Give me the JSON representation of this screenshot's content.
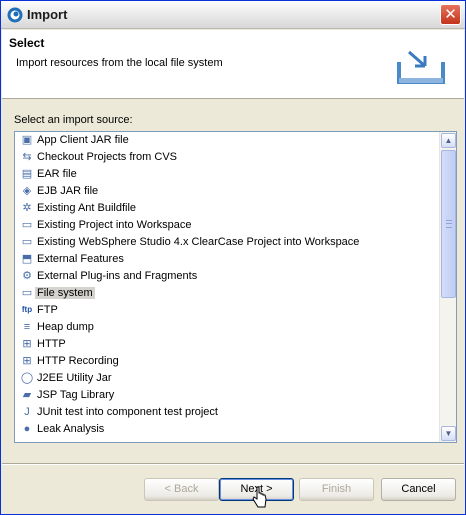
{
  "window": {
    "title": "Import",
    "close_glyph": "✕"
  },
  "header": {
    "title": "Select",
    "description": "Import resources from the local file system"
  },
  "list": {
    "label": "Select an import source:",
    "items": [
      {
        "label": "App Client JAR file",
        "icon": "jar-icon",
        "glyph": "▣"
      },
      {
        "label": "Checkout Projects from CVS",
        "icon": "cvs-icon",
        "glyph": "⇆"
      },
      {
        "label": "EAR file",
        "icon": "ear-icon",
        "glyph": "▤"
      },
      {
        "label": "EJB JAR file",
        "icon": "ejb-icon",
        "glyph": "◈"
      },
      {
        "label": "Existing Ant Buildfile",
        "icon": "ant-icon",
        "glyph": "✲"
      },
      {
        "label": "Existing Project into Workspace",
        "icon": "project-icon",
        "glyph": "▭"
      },
      {
        "label": "Existing WebSphere Studio 4.x ClearCase Project into Workspace",
        "icon": "clearcase-icon",
        "glyph": "▭"
      },
      {
        "label": "External Features",
        "icon": "feature-icon",
        "glyph": "⬒"
      },
      {
        "label": "External Plug-ins and Fragments",
        "icon": "plugin-icon",
        "glyph": "⚙"
      },
      {
        "label": "File system",
        "icon": "folder-icon",
        "glyph": "▭",
        "selected": true
      },
      {
        "label": "FTP",
        "icon": "ftp-icon",
        "glyph": "ftp"
      },
      {
        "label": "Heap dump",
        "icon": "heap-icon",
        "glyph": "≡"
      },
      {
        "label": "HTTP",
        "icon": "http-icon",
        "glyph": "⊞"
      },
      {
        "label": "HTTP Recording",
        "icon": "recording-icon",
        "glyph": "⊞"
      },
      {
        "label": "J2EE Utility Jar",
        "icon": "utility-jar-icon",
        "glyph": "◯"
      },
      {
        "label": "JSP Tag Library",
        "icon": "taglib-icon",
        "glyph": "▰"
      },
      {
        "label": "JUnit test into component test project",
        "icon": "junit-icon",
        "glyph": "J"
      },
      {
        "label": "Leak Analysis",
        "icon": "drop-icon",
        "glyph": "●"
      }
    ]
  },
  "buttons": {
    "back": "< Back",
    "next": "Next >",
    "finish": "Finish",
    "cancel": "Cancel"
  },
  "colors": {
    "selection": "#d5d3cd",
    "dialog_bg": "#ece9d8",
    "list_border": "#7f9db9"
  }
}
